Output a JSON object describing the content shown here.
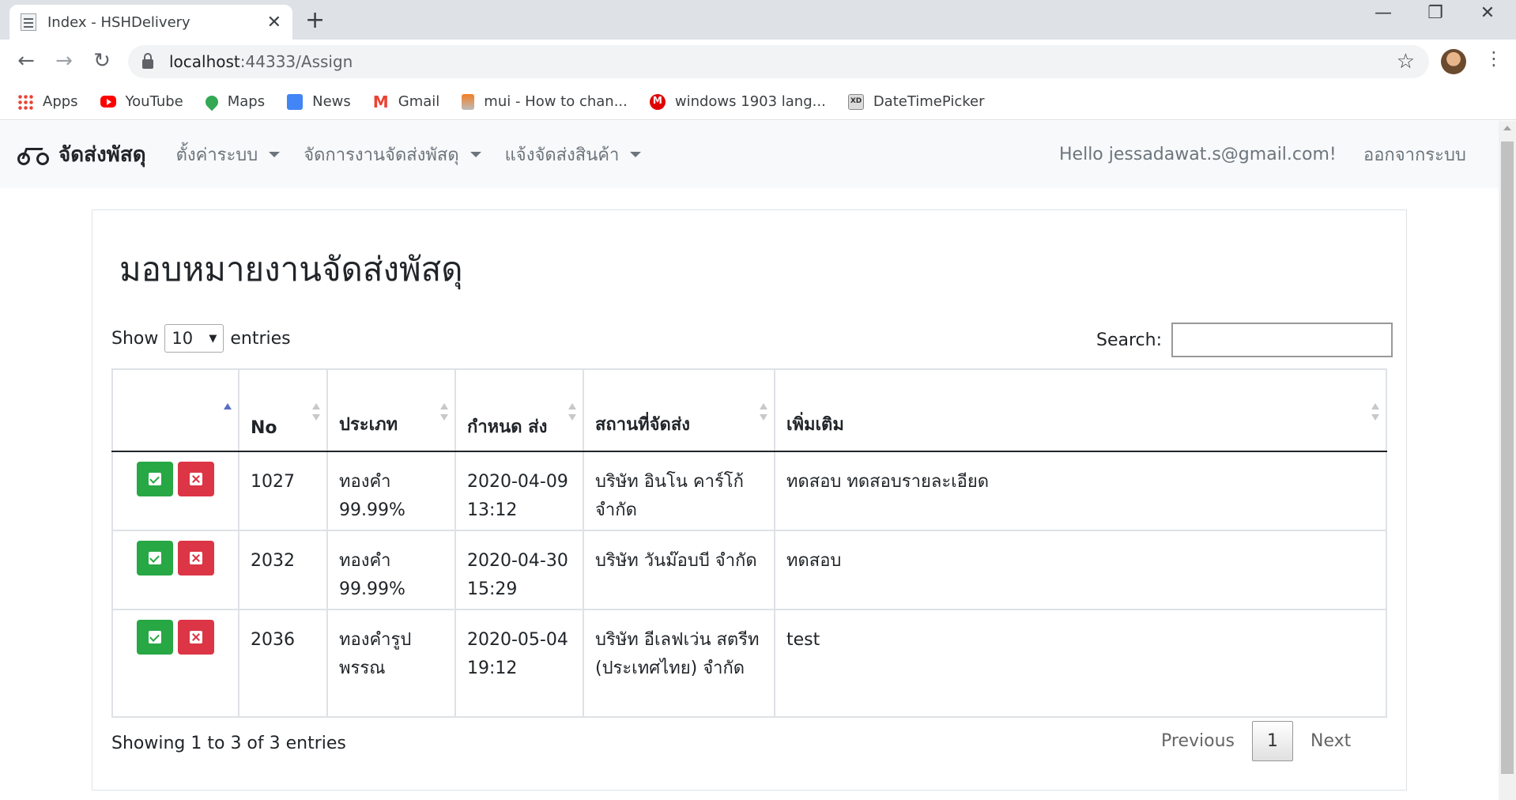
{
  "browser": {
    "tab_title": "Index - HSHDelivery",
    "tab_close": "✕",
    "new_tab": "+",
    "minimize": "—",
    "restore": "❐",
    "close": "✕",
    "back": "←",
    "forward": "→",
    "reload": "↻",
    "url_host": "localhost",
    "url_rest": ":44333/Assign",
    "star": "☆",
    "menu": "⋮"
  },
  "bookmarks": [
    {
      "label": "Apps",
      "icon": "apps-icon"
    },
    {
      "label": "YouTube",
      "icon": "youtube-icon"
    },
    {
      "label": "Maps",
      "icon": "maps-icon"
    },
    {
      "label": "News",
      "icon": "news-icon"
    },
    {
      "label": "Gmail",
      "icon": "gmail-icon"
    },
    {
      "label": "mui - How to chan...",
      "icon": "stackoverflow-icon"
    },
    {
      "label": "windows 1903 lang...",
      "icon": "mui-icon"
    },
    {
      "label": "DateTimePicker",
      "icon": "xd-icon"
    }
  ],
  "appnav": {
    "brand": "จัดส่งพัสดุ",
    "menus": [
      "ตั้งค่าระบบ",
      "จัดการงานจัดส่งพัสดุ",
      "แจ้งจัดส่งสินค้า"
    ],
    "hello": "Hello jessadawat.s@gmail.com!",
    "logout": "ออกจากระบบ"
  },
  "page": {
    "title": "มอบหมายงานจัดส่งพัสดุ",
    "show_label": "Show",
    "entries_label": "entries",
    "page_size": "10",
    "search_label": "Search:",
    "search_value": ""
  },
  "table": {
    "headers": [
      "",
      "No",
      "ประเภท",
      "กำหนด ส่ง",
      "สถานที่จัดส่ง",
      "เพิ่มเติม"
    ],
    "rows": [
      {
        "no": "1027",
        "type": "ทองคำ 99.99%",
        "due": "2020-04-09 13:12",
        "place": "บริษัท อินโน คาร์โก้ จำกัด",
        "note": "ทดสอบ ทดสอบรายละเอียด"
      },
      {
        "no": "2032",
        "type": "ทองคำ 99.99%",
        "due": "2020-04-30 15:29",
        "place": "บริษัท วันม๊อบบี จำกัด",
        "note": "ทดสอบ"
      },
      {
        "no": "2036",
        "type": "ทองคำรูปพรรณ",
        "due": "2020-05-04 19:12",
        "place": "บริษัท อีเลฟเว่น สตรีท (ประเทศไทย) จำกัด",
        "note": "test"
      }
    ]
  },
  "footer": {
    "info": "Showing 1 to 3 of 3 entries",
    "previous": "Previous",
    "current_page": "1",
    "next": "Next"
  },
  "colors": {
    "approve": "#28a745",
    "reject": "#dc3545",
    "navbar_bg": "#f8f9fa"
  }
}
